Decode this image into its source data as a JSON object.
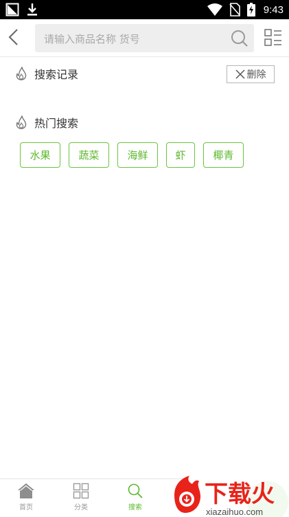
{
  "status_bar": {
    "time": "9:43"
  },
  "search": {
    "placeholder": "请输入商品名称 货号"
  },
  "history": {
    "title": "搜索记录",
    "delete_label": "删除"
  },
  "hot": {
    "title": "热门搜索",
    "tags": [
      "水果",
      "蔬菜",
      "海鲜",
      "虾",
      "椰青"
    ]
  },
  "bottom_nav": {
    "items": [
      {
        "label": "首页",
        "icon": "home-icon",
        "active": false
      },
      {
        "label": "分类",
        "icon": "grid-icon",
        "active": false
      },
      {
        "label": "搜索",
        "icon": "search-icon",
        "active": true
      }
    ]
  },
  "watermark": {
    "brand": "下载火",
    "url": "xiazaihuo.com"
  },
  "colors": {
    "accent": "#5cb82c",
    "tag_border": "#6ac43c",
    "watermark": "#e8231a"
  }
}
